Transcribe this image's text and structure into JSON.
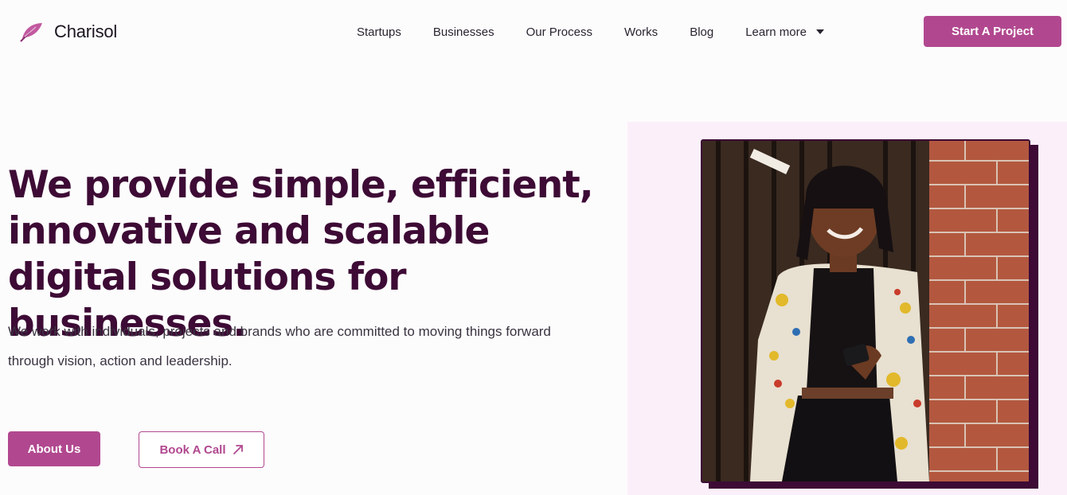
{
  "brand": {
    "name": "Charisol",
    "accent": "#b1488f",
    "dark": "#3d0b35"
  },
  "nav": {
    "items": [
      "Startups",
      "Businesses",
      "Our Process",
      "Works",
      "Blog"
    ],
    "learn_more": "Learn more"
  },
  "header": {
    "cta_label": "Start A Project"
  },
  "hero": {
    "title": "We provide simple, efficient, innovative and scalable digital solutions for businesses.",
    "subtitle": "We work with individuals, projects and brands who are committed to moving things forward through vision, action and leadership.",
    "primary_button": "About Us",
    "secondary_button": "Book A Call"
  },
  "icons": {
    "logo": "feather-logo-icon",
    "dropdown": "chevron-down-icon",
    "arrow": "arrow-up-right-icon"
  }
}
